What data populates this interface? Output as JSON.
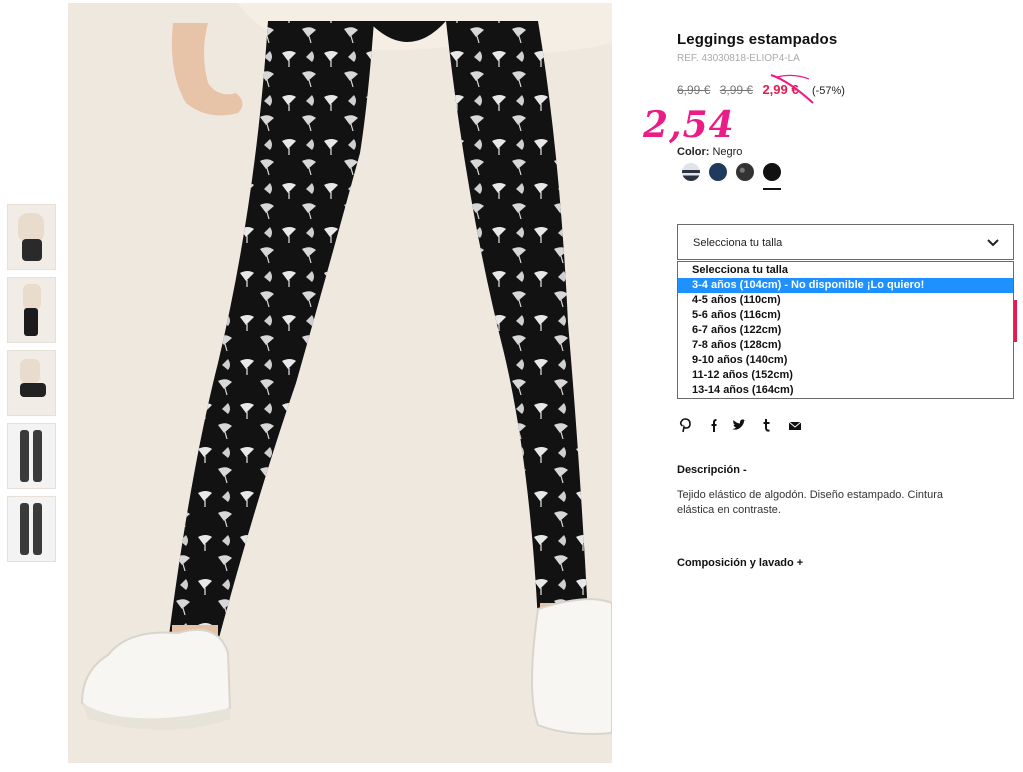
{
  "product": {
    "title": "Leggings estampados",
    "ref": "REF. 43030818-ELIOP4-LA",
    "prices": {
      "old1": "6,99 €",
      "old2": "3,99 €",
      "current": "2,99 €",
      "discount": "(-57%)"
    },
    "handwritten_price": "2,54",
    "color_label": "Color:",
    "color_value": "Negro",
    "swatches": [
      {
        "name": "Rayas",
        "color": "#2b3340"
      },
      {
        "name": "Marino",
        "color": "#1f3a5c"
      },
      {
        "name": "Estampado gris",
        "color": "#3a3a3a"
      },
      {
        "name": "Negro",
        "color": "#111111",
        "selected": true
      }
    ]
  },
  "size_select": {
    "label": "Selecciona tu talla",
    "options": [
      "Selecciona tu talla",
      "3-4 años (104cm) - No disponible ¡Lo quiero!",
      "4-5 años (110cm)",
      "5-6 años (116cm)",
      "6-7 años (122cm)",
      "7-8 años (128cm)",
      "9-10 años (140cm)",
      "11-12 años (152cm)",
      "13-14 años (164cm)"
    ],
    "highlighted_index": 1
  },
  "social": [
    "pinterest-icon",
    "facebook-icon",
    "twitter-icon",
    "tumblr-icon",
    "email-icon"
  ],
  "description": {
    "heading": "Descripción -",
    "text": "Tejido elástico de algodón. Diseño estampado. Cintura elástica en contraste."
  },
  "composition": {
    "heading": "Composición y lavado +"
  },
  "colors": {
    "accent": "#e41b50",
    "highlight": "#1e90ff",
    "handwriting": "#ec1c87"
  }
}
